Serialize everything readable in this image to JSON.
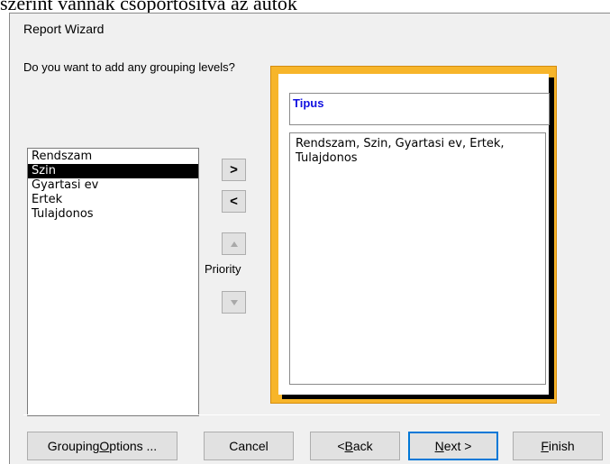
{
  "background_caption": "szerint vannak csoportosítva az autók",
  "window": {
    "title": "Report Wizard"
  },
  "question": "Do you want to add any grouping levels?",
  "fields": [
    "Rendszam",
    "Szin",
    "Gyartasi ev",
    "Ertek",
    "Tulajdonos"
  ],
  "selected_field": "Szin",
  "buttons_mid": {
    "add": ">",
    "remove": "<",
    "priority_label": "Priority"
  },
  "preview": {
    "group_header": "Tipus",
    "detail_fields": "Rendszam, Szin, Gyartasi ev, Ertek, Tulajdonos"
  },
  "footer": {
    "grouping_options": {
      "pre": "Grouping ",
      "key": "O",
      "post": "ptions ..."
    },
    "cancel": "Cancel",
    "back": {
      "pre": "< ",
      "key": "B",
      "post": "ack"
    },
    "next": {
      "pre": "",
      "key": "N",
      "post": "ext >"
    },
    "finish": {
      "pre": "",
      "key": "F",
      "post": "inish"
    }
  },
  "colors": {
    "accent": "#0078d7",
    "preview_frame": "#f7b52a",
    "group_header_text": "#1010e0",
    "selection": "#000000"
  },
  "icons": [
    "arrow-up-icon",
    "arrow-down-icon"
  ]
}
